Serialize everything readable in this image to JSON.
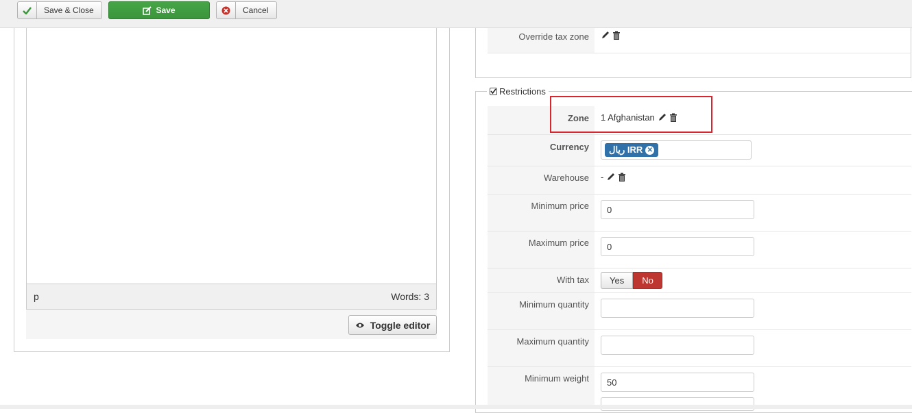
{
  "toolbar": {
    "save_close_label": "Save & Close",
    "save_label": "Save",
    "cancel_label": "Cancel"
  },
  "editor": {
    "path": "p",
    "word_count": "Words: 3",
    "toggle_label": "Toggle editor"
  },
  "top_section": {
    "override_tax_zone_label": "Override tax zone"
  },
  "restrictions": {
    "legend": "Restrictions",
    "zone_label": "Zone",
    "zone_value": "1 Afghanistan",
    "currency_label": "Currency",
    "currency_tag": "ریال IRR",
    "warehouse_label": "Warehouse",
    "warehouse_value": "-",
    "min_price_label": "Minimum price",
    "min_price_value": "0",
    "max_price_label": "Maximum price",
    "max_price_value": "0",
    "with_tax_label": "With tax",
    "with_tax_yes": "Yes",
    "with_tax_no": "No",
    "min_qty_label": "Minimum quantity",
    "min_qty_value": "",
    "max_qty_label": "Maximum quantity",
    "max_qty_value": "",
    "min_weight_label": "Minimum weight",
    "min_weight_value": "50"
  },
  "colors": {
    "save_green": "#46a546",
    "tag_blue": "#3071a9",
    "no_red": "#bd362f",
    "highlight_red": "#d9262e"
  },
  "icons": [
    "check-icon",
    "edit-icon",
    "cancel-icon",
    "eye-icon",
    "pencil-icon",
    "trash-icon"
  ]
}
